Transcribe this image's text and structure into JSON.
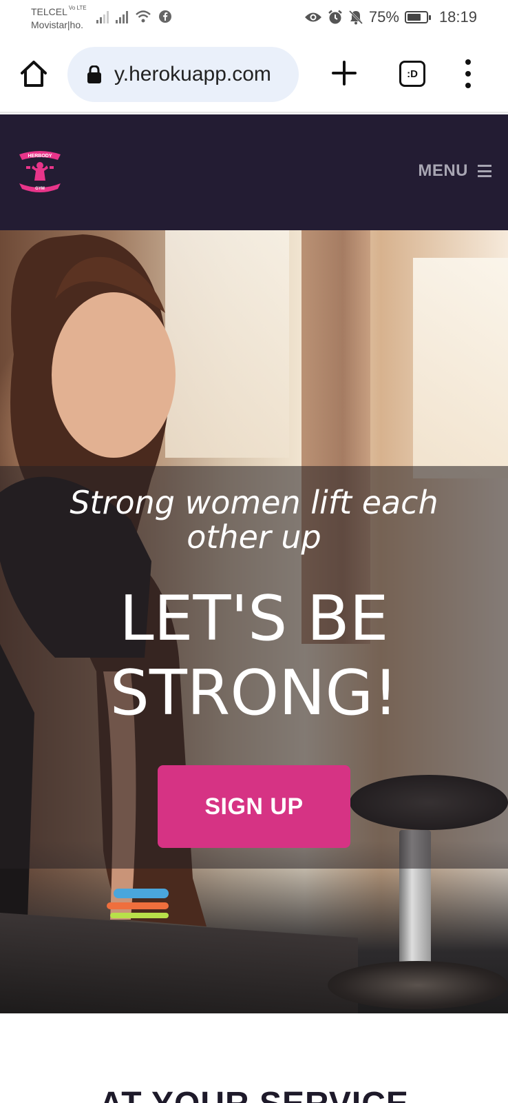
{
  "status_bar": {
    "carrier_1": "TELCEL",
    "carrier_1_tag": "Vo LTE",
    "carrier_2": "Movistar|ho.",
    "battery_percent": "75%",
    "battery_level": 0.75,
    "time": "18:19",
    "icons": [
      "signal-icon",
      "signal-icon",
      "wifi-icon",
      "facebook-icon",
      "eye-icon",
      "alarm-icon",
      "mute-icon",
      "battery-icon"
    ]
  },
  "browser": {
    "url": "y.herokuapp.com",
    "tab_switcher_label": ":D",
    "icons": [
      "home-icon",
      "lock-icon",
      "plus-icon",
      "tabs-icon",
      "more-icon"
    ]
  },
  "site_nav": {
    "logo_text_top": "HERBODY",
    "logo_text_bottom": "GYM",
    "menu_label": "MENU",
    "background": "#231c33"
  },
  "hero": {
    "tagline": "Strong women lift each other up",
    "title": "LET'S BE STRONG!",
    "signup_label": "SIGN UP",
    "accent": "#d63384"
  },
  "next_section": {
    "title": "AT YOUR SERVICE"
  }
}
